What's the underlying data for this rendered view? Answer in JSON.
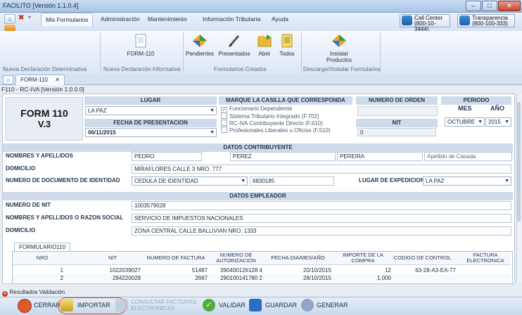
{
  "window": {
    "title": "FACILITO [Versión 1.1.0.4]",
    "min": "–",
    "max": "□",
    "close": "✕"
  },
  "ribbon": {
    "tabs": [
      "Mis Formularios",
      "Administración",
      "Mantenimiento",
      "Información Tributaria",
      "Ayuda"
    ],
    "call_center": {
      "line1": "Call Center",
      "line2": "(800-10-3444)"
    },
    "transparencia": {
      "line1": "Transparencia",
      "line2": "(800-100-333)"
    },
    "buttons": {
      "form110": "FORM-110",
      "pendientes": "Pendientes",
      "presentados": "Presentados",
      "abrir": "Abrir",
      "todos": "Todos",
      "instalar_1": "Instalar",
      "instalar_2": "Productos"
    },
    "groups": {
      "g1": "Nueva Declaración Determinativa",
      "g2": "Nueva Declaración Informativa",
      "g3": "Formularios Creados",
      "g4": "Descargar/Instalar Formularios"
    }
  },
  "doc_tab": {
    "label": "FORM-110",
    "close": "✕"
  },
  "form_title": "F110 - RC-IVA [Versión 1.0.0.0]",
  "form": {
    "badge_1": "FORM 110",
    "badge_2": "V.3",
    "lugar_header": "LUGAR",
    "lugar_value": "LA PAZ",
    "fecha_header": "FECHA DE PRESENTACION",
    "fecha_value": "06/11/2015",
    "marque_header": "MARQUE LA CASILLA QUE CORRESPONDA",
    "checks": [
      {
        "label": "Funcionario Dependiente",
        "checked": "✓"
      },
      {
        "label": "Sistema Tributario Integrado (F.702)",
        "checked": ""
      },
      {
        "label": "RC-IVA Contribuyente Directo (F.610)",
        "checked": ""
      },
      {
        "label": "Profesionales Liberales u Oficios (F.510)",
        "checked": ""
      }
    ],
    "orden_header": "NUMERO DE ORDEN",
    "nit_header": "NIT",
    "nit_value": "0",
    "periodo_header": "PERIODO",
    "mes_label": "MES",
    "anio_label": "AÑO",
    "mes_value": "OCTUBRE",
    "anio_value": "2015"
  },
  "contribuyente": {
    "header": "DATOS CONTRIBUYENTE",
    "nombres_label": "NOMBRES Y APELLIDOS",
    "nombre": "PEDRO",
    "apellido1": "PEREZ",
    "apellido2": "PEREIRA",
    "apellido_casada_placeholder": "Apellido de Casada",
    "domicilio_label": "DOMICILIO",
    "domicilio": "MIRAFLORES CALLE 3 NRO. 777",
    "doc_label": "NUMERO DE DOCUMENTO DE IDENTIDAD",
    "doc_type": "CEDULA DE IDENTIDAD",
    "doc_number": "6830185",
    "expedicion_label": "LUGAR DE EXPEDICION",
    "expedicion": "LA PAZ"
  },
  "empleador": {
    "header": "DATOS EMPLEADOR",
    "nit_label": "NUMERO DE NIT",
    "nit": "1003579028",
    "razon_label": "NOMBRES Y APELLIDOS O RAZON SOCIAL",
    "razon": "SERVICIO DE IMPUESTOS NACIONALES",
    "domicilio_label": "DOMICILIO",
    "domicilio": "ZONA CENTRAL CALLE BALLIVIAN NRO. 1333"
  },
  "table": {
    "tab_label": "FORMULARIO110",
    "columns": [
      "NRO",
      "NIT",
      "NUMERO DE FACTURA",
      "NUMERO DE AUTORIZACION",
      "FECHA DIA/MES/AÑO",
      "IMPORTE DE LA COMPRA",
      "CODIGO DE CONTROL",
      "FACTURA ELECTRONICA"
    ],
    "rows": [
      {
        "nro": "1",
        "nit": "1022039027",
        "factura": "51487",
        "autorizacion": "390400126128 4",
        "fecha": "20/10/2015",
        "importe": "12",
        "codigo": "63-28-A3-EA-77",
        "electronica": ""
      },
      {
        "nro": "2",
        "nit": "284220028",
        "factura": "2667",
        "autorizacion": "290100141780 2",
        "fecha": "28/10/2015",
        "importe": "1,000",
        "codigo": "",
        "electronica": ""
      }
    ]
  },
  "results_tab": "Resultados Validación",
  "actions": {
    "cerrar": "CERRAR",
    "importar": "IMPORTAR",
    "consultar_1": "CONSULTAR FACTURAS",
    "consultar_2": "ELECTRONICAS",
    "validar": "VALIDAR",
    "guardar": "GUARDAR",
    "generar": "GENERAR"
  }
}
